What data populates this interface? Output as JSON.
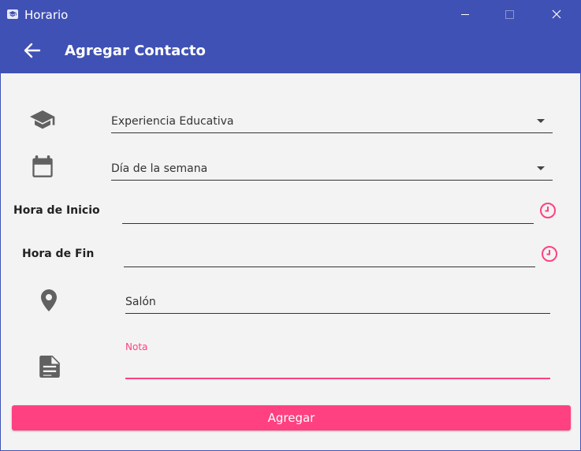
{
  "window": {
    "title": "Horario",
    "accent_color": "#3f51b5",
    "controls": [
      "minimize-icon",
      "maximize-icon",
      "close-icon"
    ]
  },
  "appbar": {
    "title": "Agregar Contacto",
    "back_icon": "arrow-left-icon"
  },
  "form": {
    "course": {
      "icon": "graduation-cap-icon",
      "value": "Experiencia Educativa"
    },
    "day": {
      "icon": "calendar-icon",
      "value": "Día de la semana"
    },
    "start_time": {
      "label": "Hora de Inicio",
      "value": "",
      "icon": "clock-icon"
    },
    "end_time": {
      "label": "Hora de Fin",
      "value": "",
      "icon": "clock-icon"
    },
    "room": {
      "icon": "location-pin-icon",
      "value": "Salón"
    },
    "note": {
      "icon": "note-icon",
      "label": "Nota",
      "value": ""
    }
  },
  "submit": {
    "label": "Agregar",
    "color": "#ff4081"
  }
}
